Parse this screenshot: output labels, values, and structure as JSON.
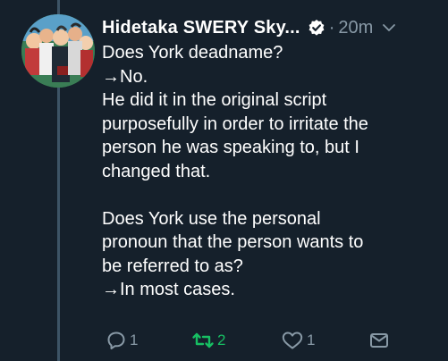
{
  "tweet": {
    "author_name": "Hidetaka SWERY Sky...",
    "separator": "·",
    "timestamp": "20m",
    "lines": [
      "Does York deadname?",
      "→No.",
      "He did it in the original script",
      "purposefully in order to irritate the",
      "person he was speaking to, but I",
      "changed that.",
      "",
      "Does York use the personal",
      "pronoun that the person wants to",
      "be referred to as?",
      "→In most cases."
    ]
  },
  "actions": {
    "reply_count": "1",
    "retweet_count": "2",
    "like_count": "1"
  },
  "icons": {
    "verified": "verified-badge-icon",
    "menu": "chevron-down-icon",
    "reply": "reply-bubble-icon",
    "retweet": "retweet-arrows-icon",
    "like": "heart-outline-icon",
    "message": "envelope-icon"
  },
  "colors": {
    "background": "#15202b",
    "text": "#ffffff",
    "muted": "#8899a6",
    "retweet_active": "#17bf63",
    "thread_line": "#3d5466"
  }
}
